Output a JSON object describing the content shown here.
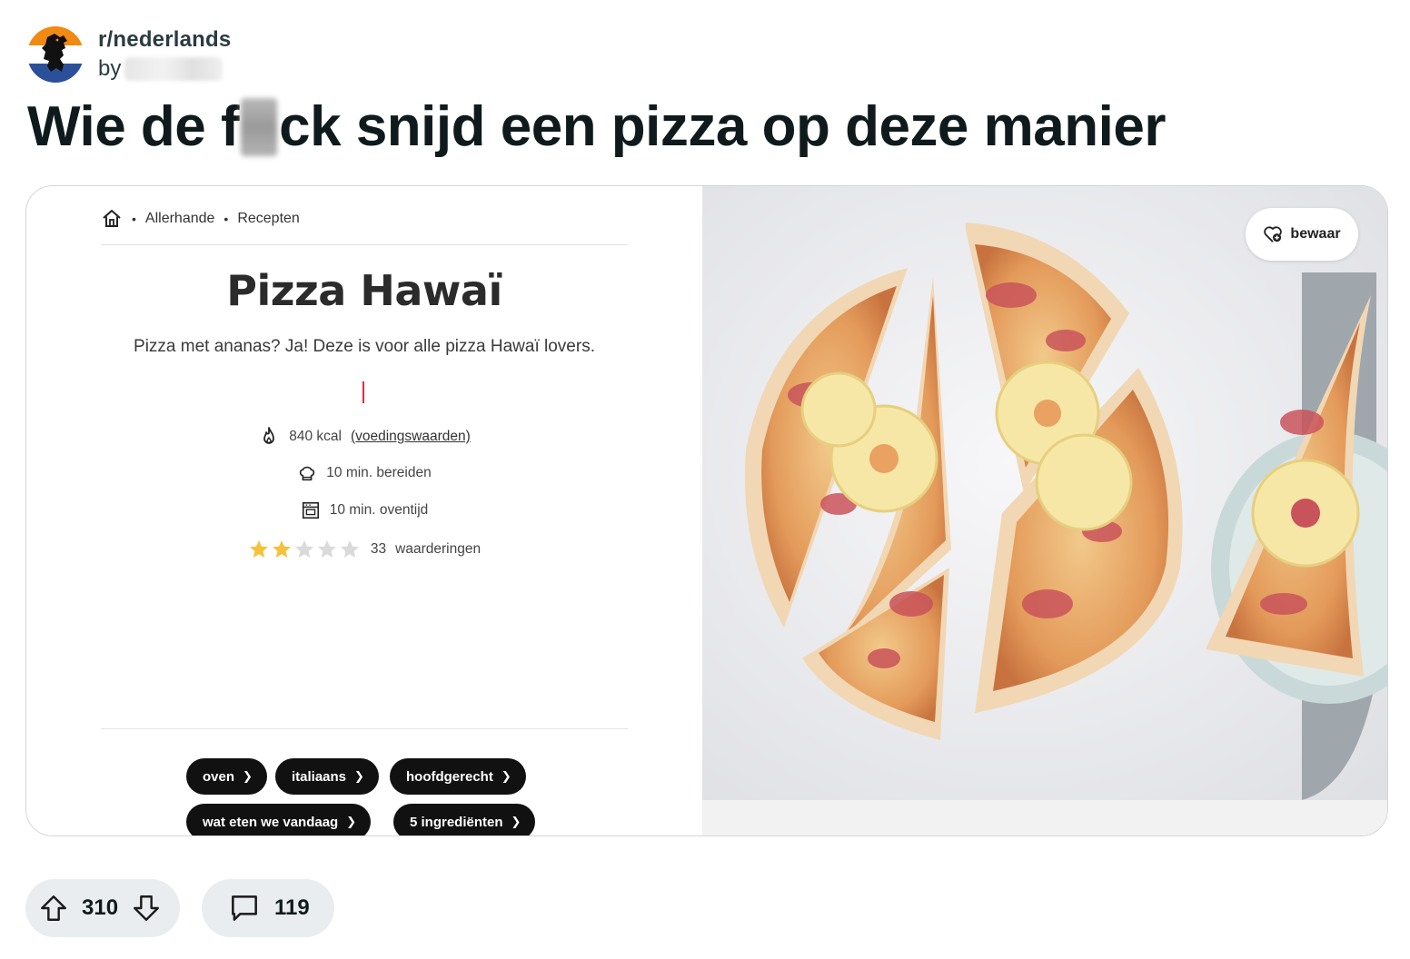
{
  "post": {
    "subreddit": "r/nederlands",
    "by_label": "by",
    "title_before": "Wie de f",
    "title_after": "ck snijd een pizza op deze manier"
  },
  "embed": {
    "breadcrumb": [
      "Allerhande",
      "Recepten"
    ],
    "recipe_title": "Pizza Hawaï",
    "recipe_subtitle": "Pizza met ananas? Ja! Deze is voor alle pizza Hawaï lovers.",
    "kcal": "840 kcal",
    "nutrition_link": "(voedingswaarden)",
    "prep_time": "10 min. bereiden",
    "oven_time": "10 min. oventijd",
    "rating": {
      "stars": 2,
      "max": 5,
      "count": "33",
      "label": "waarderingen"
    },
    "tags_row1": [
      "oven",
      "italiaans",
      "hoofdgerecht"
    ],
    "tags_row2": [
      "wat eten we vandaag",
      "5 ingrediënten"
    ],
    "save_button": "bewaar"
  },
  "actions": {
    "score": "310",
    "comments": "119"
  },
  "colors": {
    "accent_red": "#d3313c",
    "star_filled": "#f4c23d",
    "star_empty": "#dadada",
    "pill_bg": "#eaedef"
  },
  "icons": [
    "home-icon",
    "flame-icon",
    "chef-hat-icon",
    "oven-icon",
    "star-icon",
    "heart-plus-icon",
    "upvote-icon",
    "downvote-icon",
    "comment-icon"
  ]
}
